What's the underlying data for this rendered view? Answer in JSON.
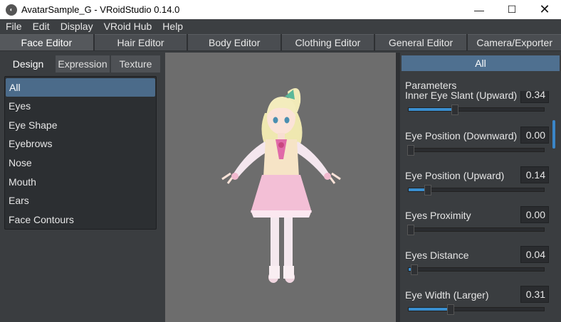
{
  "window": {
    "title": "AvatarSample_G - VRoidStudio 0.14.0",
    "app_icon": "vroid-logo-icon",
    "minimize": "—",
    "maximize": "☐",
    "close": "✕"
  },
  "menu": [
    "File",
    "Edit",
    "Display",
    "VRoid Hub",
    "Help"
  ],
  "editor_tabs": [
    "Face Editor",
    "Hair Editor",
    "Body Editor",
    "Clothing Editor",
    "General Editor",
    "Camera/Exporter"
  ],
  "sub_tabs": [
    "Design",
    "Expression",
    "Texture"
  ],
  "categories": [
    "All",
    "Eyes",
    "Eye Shape",
    "Eyebrows",
    "Nose",
    "Mouth",
    "Ears",
    "Face Contours"
  ],
  "right_panel": {
    "header": "All",
    "section_title": "Parameters",
    "parameters": [
      {
        "label": "Inner Eye Slant (Upward)",
        "value": "0.34",
        "fraction": 0.34
      },
      {
        "label": "Eye Position (Downward)",
        "value": "0.00",
        "fraction": 0.0
      },
      {
        "label": "Eye Position (Upward)",
        "value": "0.14",
        "fraction": 0.14
      },
      {
        "label": "Eyes Proximity",
        "value": "0.00",
        "fraction": 0.0
      },
      {
        "label": "Eyes Distance",
        "value": "0.04",
        "fraction": 0.04
      },
      {
        "label": "Eye Width (Larger)",
        "value": "0.31",
        "fraction": 0.31
      }
    ]
  },
  "colors": {
    "accent_blue": "#3a8fd0",
    "selected_item": "#4b6b8a",
    "viewport_bg": "#6d6d6d"
  }
}
